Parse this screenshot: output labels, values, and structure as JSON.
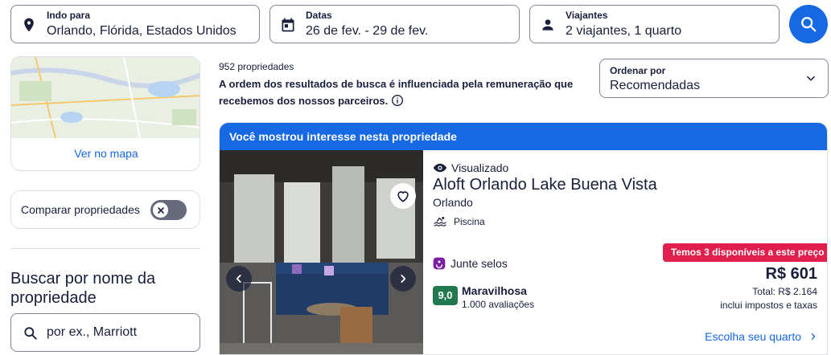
{
  "search": {
    "destination": {
      "label": "Indo para",
      "value": "Orlando, Flórida, Estados Unidos"
    },
    "dates": {
      "label": "Datas",
      "value": "26 de fev. - 29 de fev."
    },
    "travelers": {
      "label": "Viajantes",
      "value": "2 viajantes, 1 quarto"
    }
  },
  "sidebar": {
    "map_link": "Ver no mapa",
    "compare_label": "Comparar propriedades",
    "compare_enabled": false,
    "name_search_title": "Buscar por nome da propriedade",
    "name_search_placeholder": "por ex., Marriott"
  },
  "results": {
    "count": "952 propriedades",
    "notice": "A ordem dos resultados de busca é influenciada pela remuneração que recebemos dos nossos parceiros.",
    "sort_label": "Ordenar por",
    "sort_value": "Recomendadas"
  },
  "property": {
    "banner": "Você mostrou interesse nesta propriedade",
    "viewed": "Visualizado",
    "name": "Aloft Orlando Lake Buena Vista",
    "city": "Orlando",
    "amenity": "Piscina",
    "availability": "Temos 3 disponíveis a este preço",
    "stamps": "Junte selos",
    "price": "R$ 601",
    "total": "Total: R$ 2.164",
    "taxes": "inclui impostos e taxas",
    "rating": "9,0",
    "rating_word": "Maravilhosa",
    "reviews": "1.000 avaliações",
    "choose": "Escolha seu quarto"
  },
  "colors": {
    "accent": "#1668e3",
    "badge": "#e01f4c",
    "rating": "#227950",
    "stamps": "#7b1fa2"
  }
}
